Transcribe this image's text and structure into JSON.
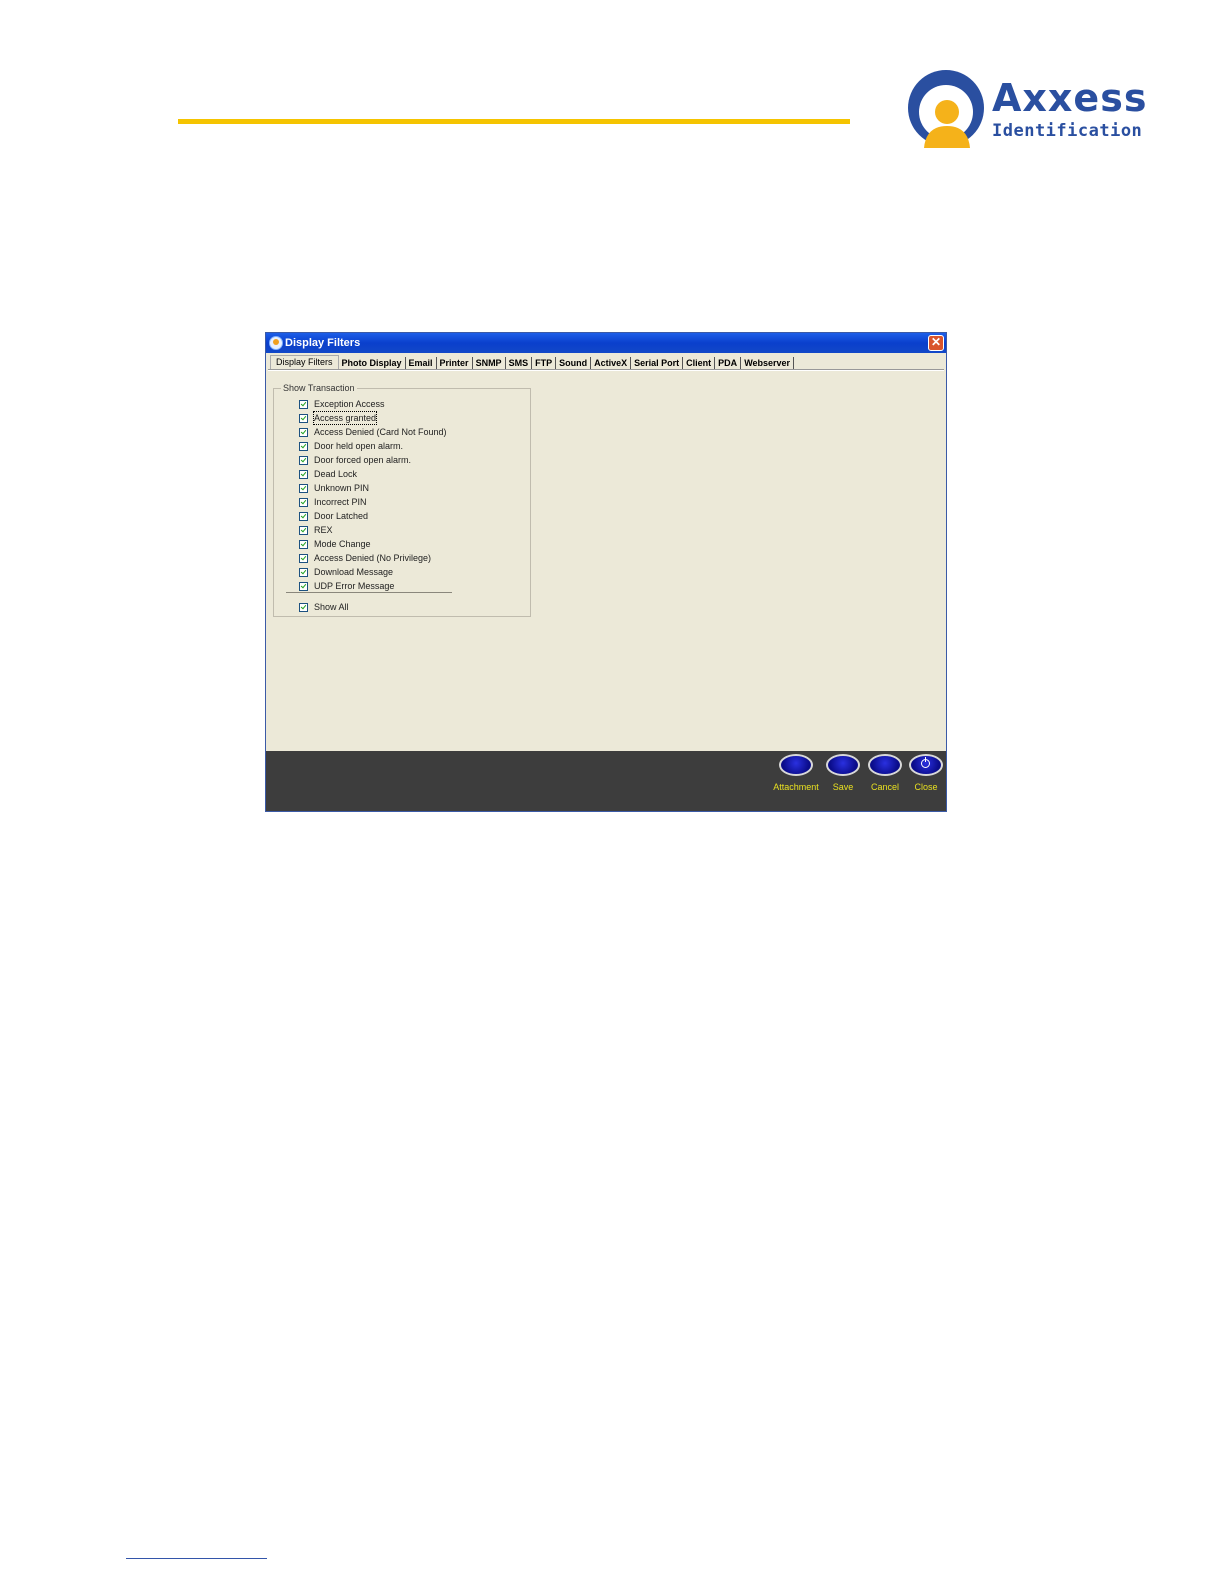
{
  "brand": {
    "name": "Axxess",
    "sub": "Identification",
    "accent": "#f5c400",
    "color": "#2a4fa0"
  },
  "window": {
    "title": "Display Filters",
    "close_glyph": "✕"
  },
  "tabs": [
    "Display Filters",
    "Photo Display",
    "Email",
    "Printer",
    "SNMP",
    "SMS",
    "FTP",
    "Sound",
    "ActiveX",
    "Serial Port",
    "Client",
    "PDA",
    "Webserver"
  ],
  "group": {
    "label": "Show Transaction",
    "items": [
      {
        "label": "Exception Access",
        "checked": true
      },
      {
        "label": "Access granted",
        "checked": true
      },
      {
        "label": "Access Denied (Card Not Found)",
        "checked": true
      },
      {
        "label": "Door held open alarm.",
        "checked": true
      },
      {
        "label": "Door forced open alarm.",
        "checked": true
      },
      {
        "label": "Dead Lock",
        "checked": true
      },
      {
        "label": "Unknown PIN",
        "checked": true
      },
      {
        "label": "Incorrect PIN",
        "checked": true
      },
      {
        "label": "Door Latched",
        "checked": true
      },
      {
        "label": "REX",
        "checked": true
      },
      {
        "label": "Mode Change",
        "checked": true
      },
      {
        "label": "Access Denied (No Privilege)",
        "checked": true
      },
      {
        "label": "Download Message",
        "checked": true
      },
      {
        "label": "UDP Error Message",
        "checked": true
      }
    ],
    "show_all": {
      "label": "Show All",
      "checked": true
    }
  },
  "buttons": {
    "attachment": "Attachment",
    "save": "Save",
    "cancel": "Cancel",
    "close": "Close"
  }
}
